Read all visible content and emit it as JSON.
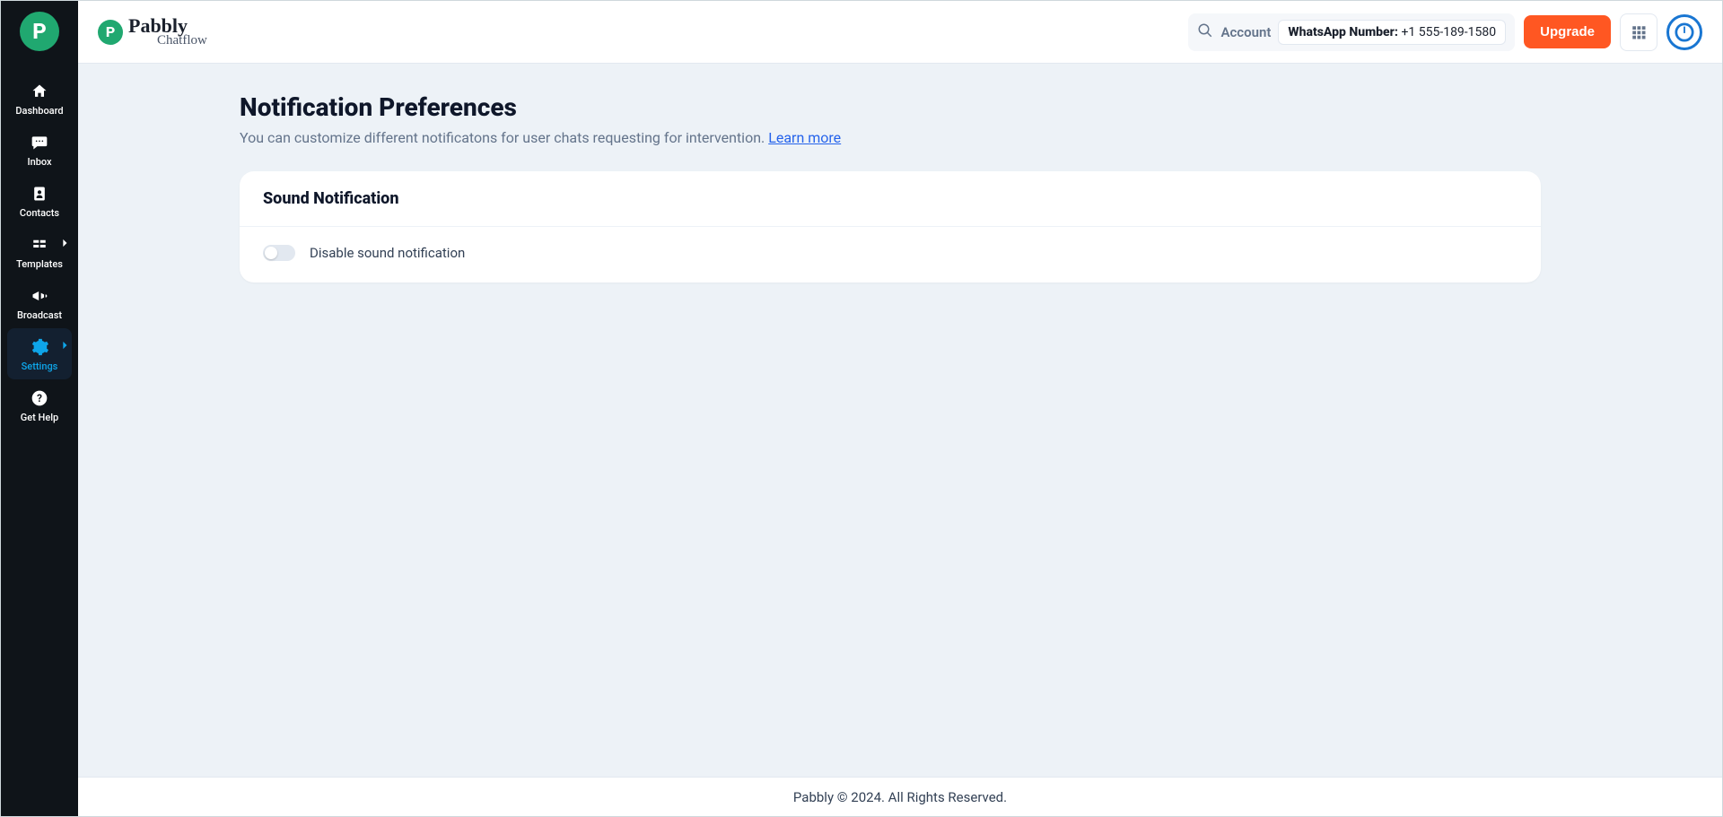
{
  "brand": {
    "name": "Pabbly",
    "sub": "Chatflow",
    "logo_letter": "P"
  },
  "sidebar": {
    "items": [
      {
        "label": "Dashboard",
        "icon": "house",
        "chevron": false
      },
      {
        "label": "Inbox",
        "icon": "chat",
        "chevron": false
      },
      {
        "label": "Contacts",
        "icon": "contact",
        "chevron": false
      },
      {
        "label": "Templates",
        "icon": "template",
        "chevron": true
      },
      {
        "label": "Broadcast",
        "icon": "megaphone",
        "chevron": false
      },
      {
        "label": "Settings",
        "icon": "gear",
        "chevron": true,
        "active": true
      },
      {
        "label": "Get Help",
        "icon": "help",
        "chevron": false
      }
    ]
  },
  "header": {
    "account_label": "Account",
    "whatsapp_label": "WhatsApp Number:",
    "whatsapp_number": "+1 555-189-1580",
    "upgrade": "Upgrade"
  },
  "page": {
    "title": "Notification Preferences",
    "desc": "You can customize different notificatons for user chats requesting for intervention. ",
    "learn_more": "Learn more"
  },
  "card": {
    "title": "Sound Notification",
    "toggle_label": "Disable sound notification",
    "toggle_on": false
  },
  "footer": {
    "text": "Pabbly © 2024. All Rights Reserved."
  }
}
